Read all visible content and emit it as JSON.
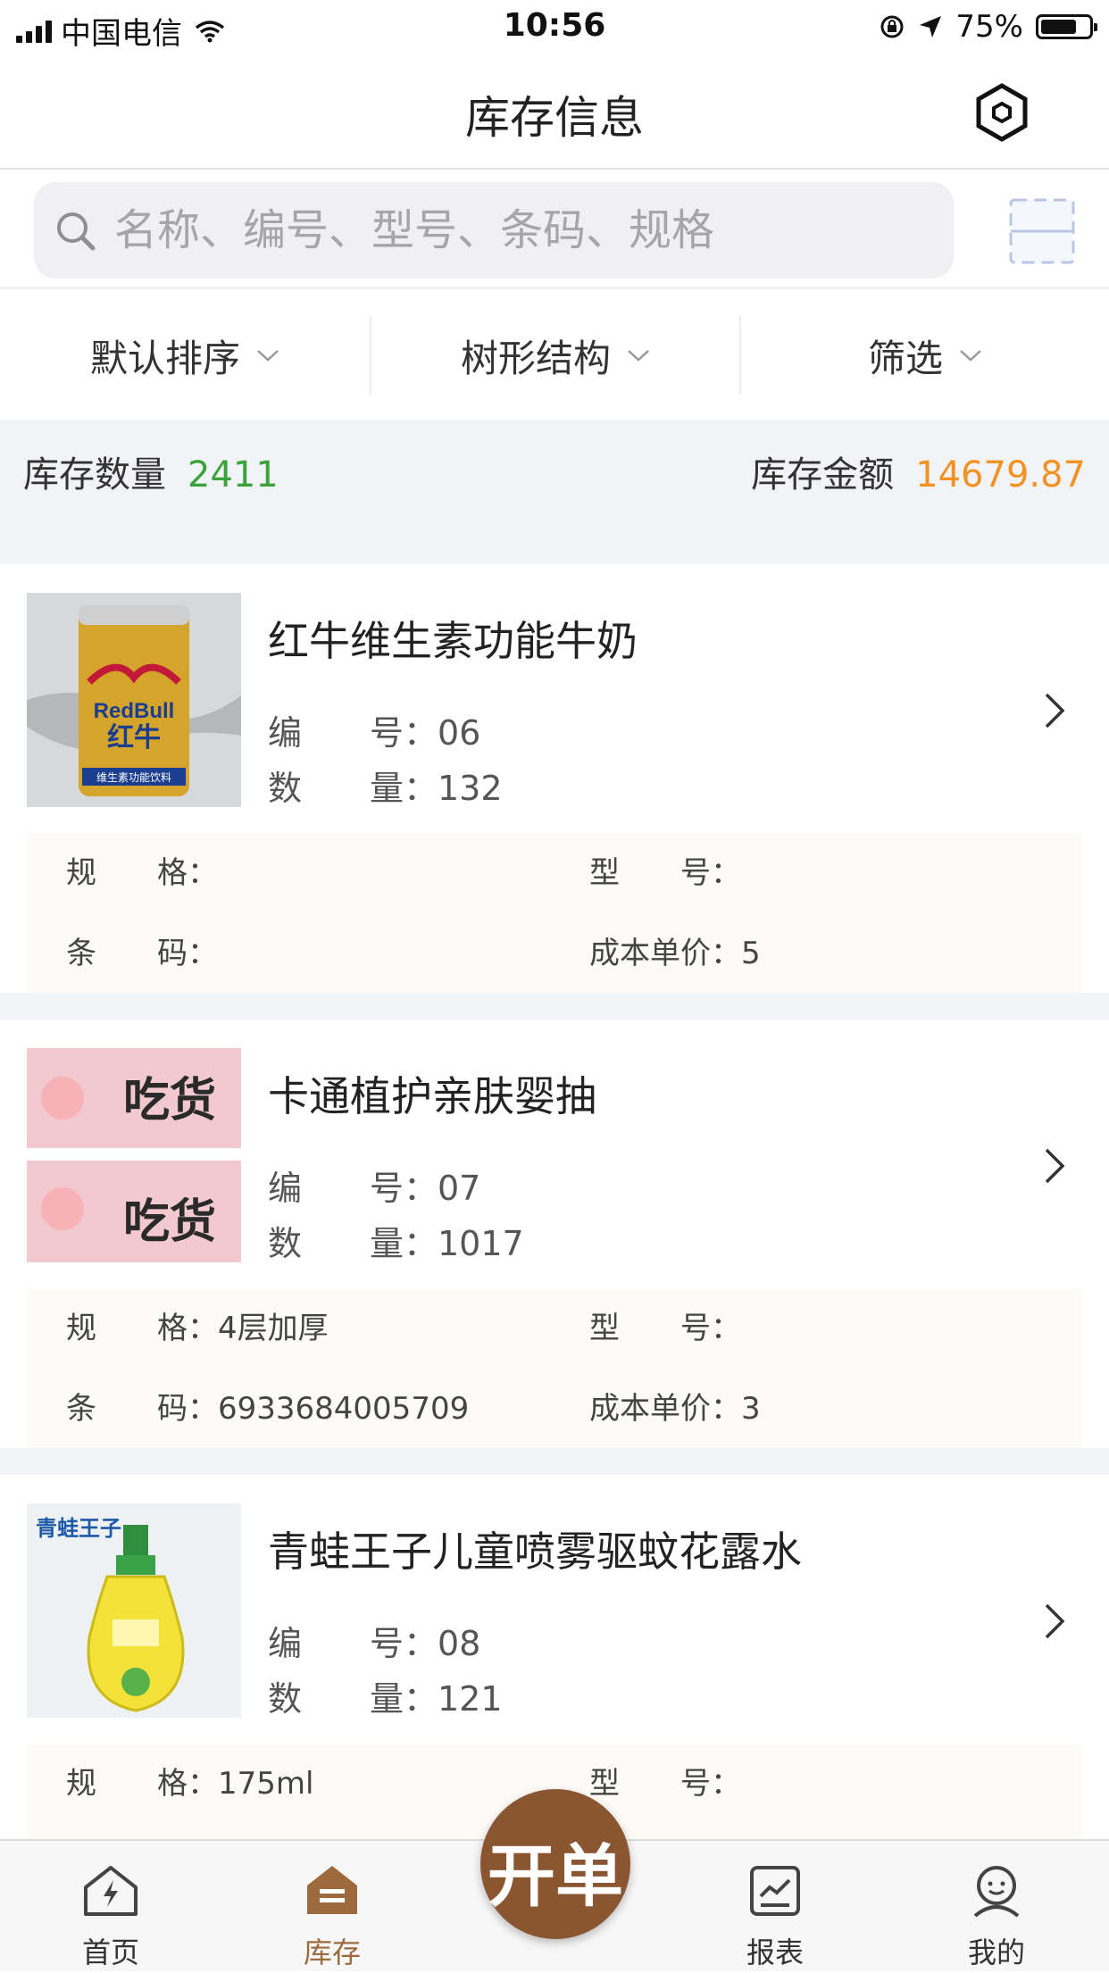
{
  "status_bar": {
    "carrier": "中国电信",
    "time": "10:56",
    "battery": "75%",
    "battery_level": 0.75
  },
  "header": {
    "title": "库存信息",
    "settings_icon": "hexagon-settings-icon"
  },
  "search": {
    "placeholder": "名称、编号、型号、条码、规格",
    "scan_icon": "scan-icon"
  },
  "filters": [
    {
      "label": "默认排序"
    },
    {
      "label": "树形结构"
    },
    {
      "label": "筛选"
    }
  ],
  "summary": {
    "qty_label": "库存数量",
    "qty_value": "2411",
    "amount_label": "库存金额",
    "amount_value": "14679.87",
    "qty_color": "#3aa33a",
    "amount_color": "#f29222"
  },
  "labels": {
    "code": "编　　号：",
    "qty": "数　　量：",
    "spec": "规　　格：",
    "model": "型　　号：",
    "barcode": "条　　码：",
    "cost": "成本单价："
  },
  "products": [
    {
      "name": "红牛维生素功能牛奶",
      "code": "06",
      "qty": "132",
      "spec": "",
      "model": "",
      "barcode": "",
      "cost": "5",
      "image_text": "RedBull 红牛 维生素功能饮料"
    },
    {
      "name": "卡通植护亲肤婴抽",
      "code": "07",
      "qty": "1017",
      "spec": "4层加厚",
      "model": "",
      "barcode": "6933684005709",
      "cost": "3",
      "image_text": "吃货 Eat"
    },
    {
      "name": "青蛙王子儿童喷雾驱蚊花露水",
      "code": "08",
      "qty": "121",
      "spec": "175ml",
      "model": "",
      "barcode": "",
      "cost": "",
      "image_text": "青蛙王子"
    }
  ],
  "tabbar": {
    "tabs": [
      {
        "label": "首页",
        "icon": "home-bolt-icon"
      },
      {
        "label": "库存",
        "icon": "inventory-icon"
      },
      {
        "label": "报表",
        "icon": "report-icon"
      },
      {
        "label": "我的",
        "icon": "profile-icon"
      }
    ],
    "center_label": "开单",
    "active_color": "#9c6a3c",
    "brand_color": "#8a5632"
  }
}
